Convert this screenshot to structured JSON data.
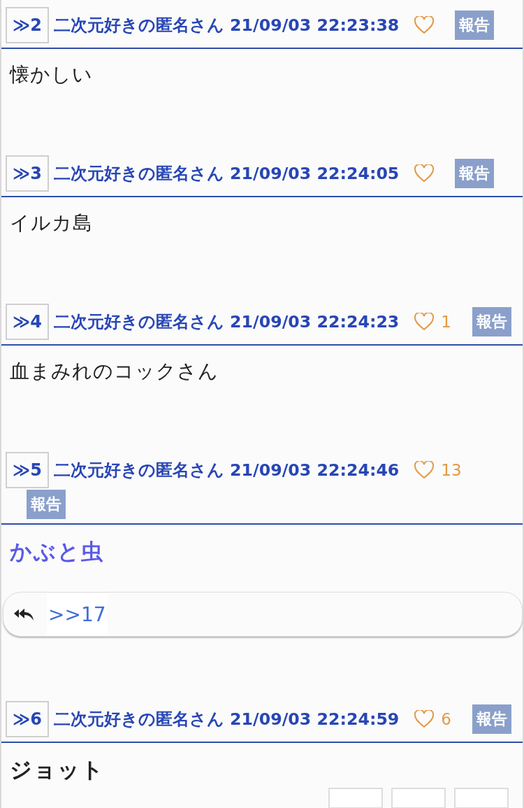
{
  "posts": [
    {
      "number": "≫2",
      "author": "二次元好きの匿名さん",
      "date": "21/09/03 22:23:38",
      "report": "報告",
      "body": "懐かしい",
      "kind": "plain"
    },
    {
      "number": "≫3",
      "author": "二次元好きの匿名さん",
      "date": "21/09/03 22:24:05",
      "report": "報告",
      "body": "イルカ島",
      "kind": "plain"
    },
    {
      "number": "≫4",
      "author": "二次元好きの匿名さん",
      "date": "21/09/03 22:24:23",
      "likes": "1",
      "report": "報告",
      "body": "血まみれのコックさん",
      "kind": "plain"
    },
    {
      "number": "≫5",
      "author": "二次元好きの匿名さん",
      "date": "21/09/03 22:24:46",
      "likes": "13",
      "report": "報告",
      "body": "かぶと虫",
      "kind": "highlight",
      "reply": ">>17"
    },
    {
      "number": "≫6",
      "author": "二次元好きの匿名さん",
      "date": "21/09/03 22:24:59",
      "likes": "6",
      "report": "報告",
      "body": "ジョット",
      "kind": "bold"
    }
  ]
}
